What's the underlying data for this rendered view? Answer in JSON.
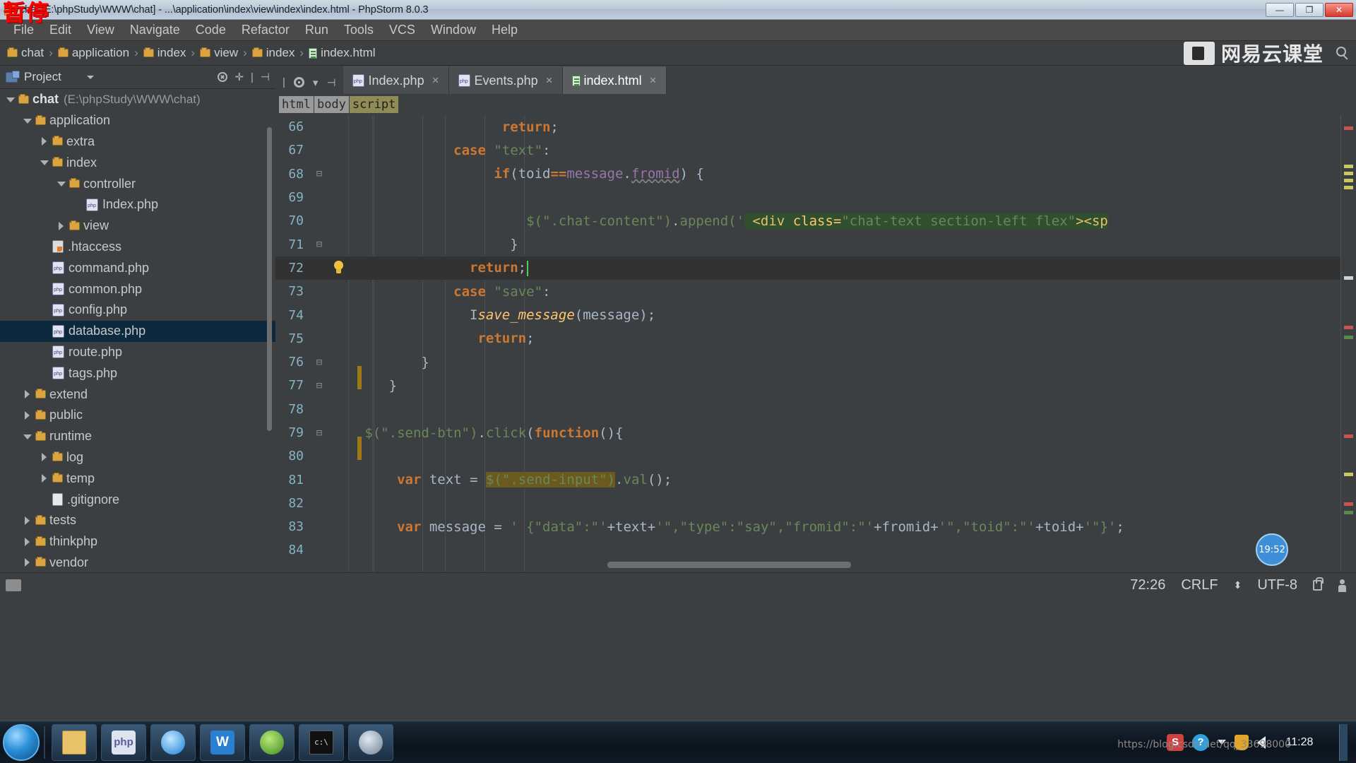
{
  "window": {
    "title": "chat [E:\\phpStudy\\WWW\\chat] - ...\\application\\index\\view\\index\\index.html - PhpStorm 8.0.3",
    "overlay_badge": "暂停",
    "minimize": "—",
    "maximize": "❐",
    "close": "✕"
  },
  "menu": [
    {
      "label": "File"
    },
    {
      "label": "Edit"
    },
    {
      "label": "View"
    },
    {
      "label": "Navigate"
    },
    {
      "label": "Code"
    },
    {
      "label": "Refactor"
    },
    {
      "label": "Run"
    },
    {
      "label": "Tools"
    },
    {
      "label": "VCS"
    },
    {
      "label": "Window"
    },
    {
      "label": "Help"
    }
  ],
  "breadcrumb": [
    {
      "label": "chat",
      "icon": "folder-icon"
    },
    {
      "label": "application",
      "icon": "folder-icon"
    },
    {
      "label": "index",
      "icon": "folder-icon"
    },
    {
      "label": "view",
      "icon": "folder-icon"
    },
    {
      "label": "index",
      "icon": "folder-icon"
    },
    {
      "label": "index.html",
      "icon": "html-file-icon"
    }
  ],
  "watermark": {
    "brand_text": "网易云课堂",
    "timer": "19:52",
    "csdn": "https://blog.csdn.net/qq_33698000"
  },
  "project_panel": {
    "title": "Project",
    "tree": [
      {
        "label": "chat",
        "path": "(E:\\phpStudy\\WWW\\chat)",
        "indent": 0,
        "arrow": "down",
        "icon": "folder-icon",
        "bold": true,
        "selected": false
      },
      {
        "label": "application",
        "path": "",
        "indent": 1,
        "arrow": "down",
        "icon": "folder-icon",
        "bold": false,
        "selected": false
      },
      {
        "label": "extra",
        "path": "",
        "indent": 2,
        "arrow": "right",
        "icon": "folder-icon",
        "bold": false,
        "selected": false
      },
      {
        "label": "index",
        "path": "",
        "indent": 2,
        "arrow": "down",
        "icon": "folder-icon",
        "bold": false,
        "selected": false
      },
      {
        "label": "controller",
        "path": "",
        "indent": 3,
        "arrow": "down",
        "icon": "folder-icon",
        "bold": false,
        "selected": false
      },
      {
        "label": "Index.php",
        "path": "",
        "indent": 4,
        "arrow": "none",
        "icon": "php-file-icon",
        "bold": false,
        "selected": false
      },
      {
        "label": "view",
        "path": "",
        "indent": 3,
        "arrow": "right",
        "icon": "folder-icon",
        "bold": false,
        "selected": false
      },
      {
        "label": ".htaccess",
        "path": "",
        "indent": 2,
        "arrow": "none",
        "icon": "htaccess-file-icon",
        "bold": false,
        "selected": false
      },
      {
        "label": "command.php",
        "path": "",
        "indent": 2,
        "arrow": "none",
        "icon": "php-file-icon",
        "bold": false,
        "selected": false
      },
      {
        "label": "common.php",
        "path": "",
        "indent": 2,
        "arrow": "none",
        "icon": "php-file-icon",
        "bold": false,
        "selected": false
      },
      {
        "label": "config.php",
        "path": "",
        "indent": 2,
        "arrow": "none",
        "icon": "php-file-icon",
        "bold": false,
        "selected": false
      },
      {
        "label": "database.php",
        "path": "",
        "indent": 2,
        "arrow": "none",
        "icon": "php-file-icon",
        "bold": false,
        "selected": true
      },
      {
        "label": "route.php",
        "path": "",
        "indent": 2,
        "arrow": "none",
        "icon": "php-file-icon",
        "bold": false,
        "selected": false
      },
      {
        "label": "tags.php",
        "path": "",
        "indent": 2,
        "arrow": "none",
        "icon": "php-file-icon",
        "bold": false,
        "selected": false
      },
      {
        "label": "extend",
        "path": "",
        "indent": 1,
        "arrow": "right",
        "icon": "folder-icon",
        "bold": false,
        "selected": false
      },
      {
        "label": "public",
        "path": "",
        "indent": 1,
        "arrow": "right",
        "icon": "folder-icon",
        "bold": false,
        "selected": false
      },
      {
        "label": "runtime",
        "path": "",
        "indent": 1,
        "arrow": "down",
        "icon": "folder-icon",
        "bold": false,
        "selected": false
      },
      {
        "label": "log",
        "path": "",
        "indent": 2,
        "arrow": "right",
        "icon": "folder-icon",
        "bold": false,
        "selected": false
      },
      {
        "label": "temp",
        "path": "",
        "indent": 2,
        "arrow": "right",
        "icon": "folder-icon",
        "bold": false,
        "selected": false
      },
      {
        "label": ".gitignore",
        "path": "",
        "indent": 2,
        "arrow": "none",
        "icon": "gitignore-file-icon",
        "bold": false,
        "selected": false
      },
      {
        "label": "tests",
        "path": "",
        "indent": 1,
        "arrow": "right",
        "icon": "folder-icon",
        "bold": false,
        "selected": false
      },
      {
        "label": "thinkphp",
        "path": "",
        "indent": 1,
        "arrow": "right",
        "icon": "folder-icon",
        "bold": false,
        "selected": false
      },
      {
        "label": "vendor",
        "path": "",
        "indent": 1,
        "arrow": "right",
        "icon": "folder-icon",
        "bold": false,
        "selected": false
      }
    ]
  },
  "editor": {
    "tabs": [
      {
        "label": "Index.php",
        "icon": "php-file-icon",
        "active": false,
        "closable": true
      },
      {
        "label": "Events.php",
        "icon": "php-file-icon",
        "active": false,
        "closable": true
      },
      {
        "label": "index.html",
        "icon": "html-file-icon",
        "active": true,
        "closable": true
      }
    ],
    "structure_crumbs": [
      {
        "label": "html",
        "current": false
      },
      {
        "label": "body",
        "current": false
      },
      {
        "label": "script",
        "current": true
      }
    ],
    "lines": [
      {
        "num": "66",
        "fold": "",
        "current": false,
        "html": "                    <span class=\"k\">return</span><span class=\"i\">;</span>"
      },
      {
        "num": "67",
        "fold": "",
        "current": false,
        "html": "              <span class=\"k\">case</span> <span class=\"s\">\"text\"</span><span class=\"i\">:</span>"
      },
      {
        "num": "68",
        "fold": "▣",
        "current": false,
        "html": "                   <span class=\"k\">if</span><span class=\"i\">(</span><span class=\"i\">toid</span><span class=\"k\">==</span><span class=\"f\">message</span><span class=\"i\">.</span><span class=\"f err\">fromid</span><span class=\"i\">) {</span>"
      },
      {
        "num": "69",
        "fold": "",
        "current": false,
        "html": ""
      },
      {
        "num": "70",
        "fold": "",
        "current": false,
        "html": "                       <span class=\"var\">$(</span><span class=\"s\">\".chat-content\"</span><span class=\"var\">)</span><span class=\"i\">.</span><span class=\"var\">append</span><span class=\"var\">('</span><span class=\"hl-green\"> <span class=\"tagname\">&lt;div</span> <span class=\"attr\">class=</span><span class=\"s\">\"chat-text section-left flex\"</span><span class=\"tagname\">&gt;&lt;sp</span></span>"
      },
      {
        "num": "71",
        "fold": "▣",
        "current": false,
        "html": "                     <span class=\"i\">}</span>"
      },
      {
        "num": "72",
        "fold": "",
        "current": true,
        "html": "                <span class=\"k\">return</span><span class=\"i\">;</span><span class=\"cursor\"></span>"
      },
      {
        "num": "73",
        "fold": "",
        "current": false,
        "html": "              <span class=\"k\">case</span> <span class=\"s\">\"save\"</span><span class=\"i\">:</span>"
      },
      {
        "num": "74",
        "fold": "",
        "current": false,
        "html": "                <span class=\"i\">I</span><span class=\"fn\" style=\"font-style:italic\">save_message</span><span class=\"i\">(</span><span class=\"i\">message</span><span class=\"i\">);</span>"
      },
      {
        "num": "75",
        "fold": "",
        "current": false,
        "html": "                 <span class=\"k\">return</span><span class=\"i\">;</span>"
      },
      {
        "num": "76",
        "fold": "▣",
        "current": false,
        "html": "          <span class=\"i\">}</span>"
      },
      {
        "num": "77",
        "fold": "▣",
        "current": false,
        "html": "      <span class=\"i\">}</span>"
      },
      {
        "num": "78",
        "fold": "",
        "current": false,
        "html": ""
      },
      {
        "num": "79",
        "fold": "▣",
        "current": false,
        "html": "   <span class=\"var\">$(</span><span class=\"s\">\".send-btn\"</span><span class=\"var\">)</span><span class=\"i\">.</span><span class=\"var\">click</span><span class=\"i\">(</span><span class=\"k\">function</span><span class=\"i\">(){</span>"
      },
      {
        "num": "80",
        "fold": "",
        "current": false,
        "html": ""
      },
      {
        "num": "81",
        "fold": "",
        "current": false,
        "html": "       <span class=\"k\">var</span> <span class=\"i\">text</span> <span class=\"i\">=</span> <span class=\"hl-brown\"><span class=\"var\">$(</span><span class=\"s\">\".send-input\"</span><span class=\"var\">)</span></span><span class=\"i\">.</span><span class=\"var\">val</span><span class=\"i\">();</span>"
      },
      {
        "num": "82",
        "fold": "",
        "current": false,
        "html": ""
      },
      {
        "num": "83",
        "fold": "",
        "current": false,
        "html": "       <span class=\"k\">var</span> <span class=\"i\">message</span> <span class=\"i\">=</span> <span class=\"s\">' {\"data\":\"'</span><span class=\"i\">+</span><span class=\"i\">text</span><span class=\"i\">+</span><span class=\"s\">'\",\"type\":\"say\",\"fromid\":\"'</span><span class=\"i\">+</span><span class=\"i\">fromid</span><span class=\"i\">+</span><span class=\"s\">'\",\"toid\":\"'</span><span class=\"i\">+</span><span class=\"i\">toid</span><span class=\"i\">+</span><span class=\"s\">'\"}'</span><span class=\"i\">;</span>"
      },
      {
        "num": "84",
        "fold": "",
        "current": false,
        "html": ""
      }
    ]
  },
  "statusbar": {
    "caret_position": "72:26",
    "line_separator": "CRLF",
    "encoding": "UTF-8",
    "lock_icon": "lock-icon",
    "person_icon": "person-icon"
  },
  "taskbar": {
    "start": "start-orb",
    "buttons": [
      {
        "name": "explorer",
        "glyph": ""
      },
      {
        "name": "phpstudy",
        "glyph": "php"
      },
      {
        "name": "internet-explorer",
        "glyph": ""
      },
      {
        "name": "wps-writer",
        "glyph": "W"
      },
      {
        "name": "phpstorm",
        "glyph": ""
      },
      {
        "name": "command-prompt",
        "glyph": "c:\\"
      },
      {
        "name": "media-player",
        "glyph": ""
      }
    ],
    "clock_time": "11:28",
    "clock_date": ""
  }
}
